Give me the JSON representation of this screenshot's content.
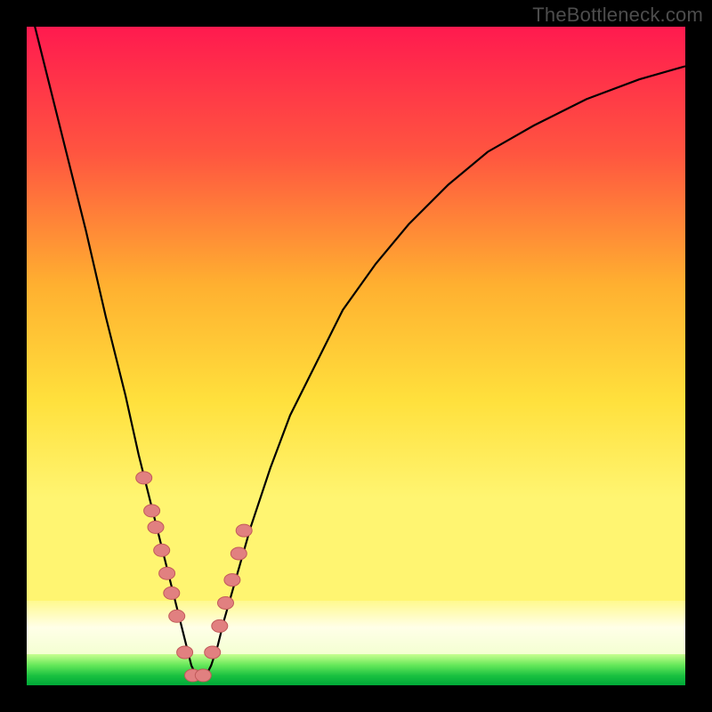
{
  "watermark": "TheBottleneck.com",
  "colors": {
    "frame": "#000000",
    "curve": "#000000",
    "marker_fill": "#e18080",
    "marker_stroke": "#c25a5a",
    "gradient_top": "#ff1a4f",
    "gradient_mid_upper": "#ff8a2a",
    "gradient_mid": "#ffd83a",
    "gradient_mid_lower": "#fff66b",
    "gradient_pale": "#ffffe8",
    "green_light": "#b8ff7a",
    "green_mid": "#4de050",
    "green_dark": "#00a838"
  },
  "chart_data": {
    "type": "line",
    "title": "",
    "xlabel": "",
    "ylabel": "",
    "xlim": [
      0,
      100
    ],
    "ylim": [
      0,
      100
    ],
    "notes": "Axes are unlabeled in source image; values are estimated on a 0–100 normalized scale. y represents distance from the optimal (green) zone; curve minimum sits near x≈26.",
    "series": [
      {
        "name": "bottleneck-curve",
        "x": [
          0,
          3,
          6,
          9,
          12,
          15,
          17,
          19,
          21,
          23,
          24,
          25,
          26,
          27,
          28,
          29,
          30,
          32,
          34,
          37,
          40,
          44,
          48,
          53,
          58,
          64,
          70,
          77,
          85,
          93,
          100
        ],
        "y": [
          105,
          93,
          81,
          69,
          56,
          44,
          35,
          27,
          19,
          11,
          7,
          3,
          1,
          1,
          3,
          6,
          10,
          17,
          24,
          33,
          41,
          49,
          57,
          64,
          70,
          76,
          81,
          85,
          89,
          92,
          94
        ]
      }
    ],
    "markers": {
      "name": "highlighted-points",
      "x": [
        17.8,
        19.0,
        19.6,
        20.5,
        21.3,
        22.0,
        22.8,
        24.0,
        25.2,
        26.8,
        28.2,
        29.3,
        30.2,
        31.2,
        32.2,
        33.0
      ],
      "y": [
        31.5,
        26.5,
        24.0,
        20.5,
        17.0,
        14.0,
        10.5,
        5.0,
        1.5,
        1.5,
        5.0,
        9.0,
        12.5,
        16.0,
        20.0,
        23.5
      ]
    },
    "green_zone": {
      "ymin": 0,
      "ymax": 5
    },
    "pale_zone": {
      "ymin": 5,
      "ymax": 13
    }
  }
}
